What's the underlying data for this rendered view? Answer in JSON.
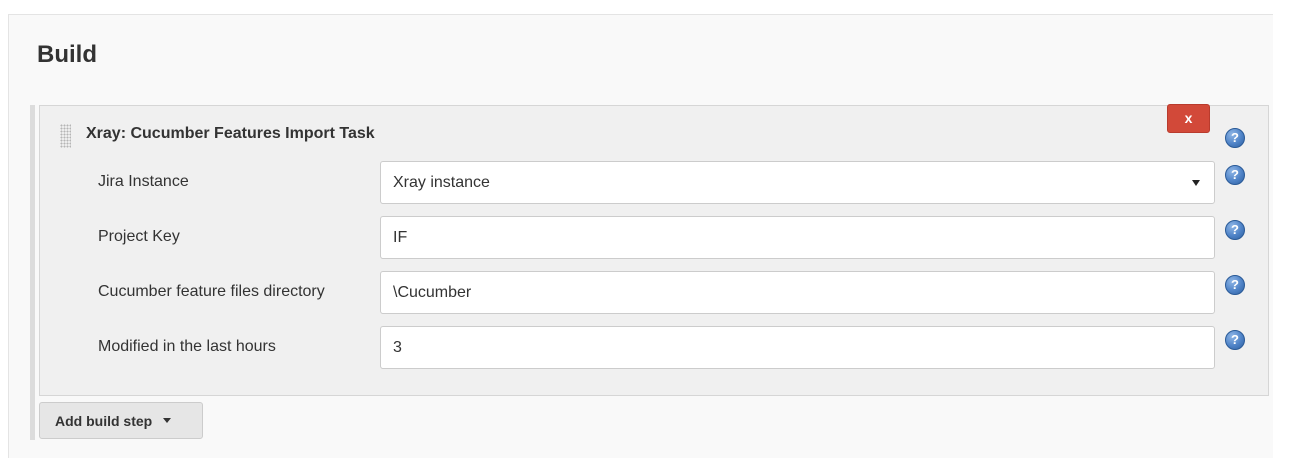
{
  "section": {
    "title": "Build"
  },
  "step": {
    "title": "Xray: Cucumber Features Import Task",
    "delete_label": "x",
    "help_glyph": "?"
  },
  "fields": {
    "jira_instance": {
      "label": "Jira Instance",
      "value": "Xray instance"
    },
    "project_key": {
      "label": "Project Key",
      "value": "IF"
    },
    "feature_dir": {
      "label": "Cucumber feature files directory",
      "value": "\\Cucumber"
    },
    "modified_hours": {
      "label": "Modified in the last hours",
      "value": "3"
    }
  },
  "actions": {
    "add_build_step": "Add build step"
  },
  "colors": {
    "delete_button": "#d24939",
    "help_icon": "#4f83c7"
  }
}
